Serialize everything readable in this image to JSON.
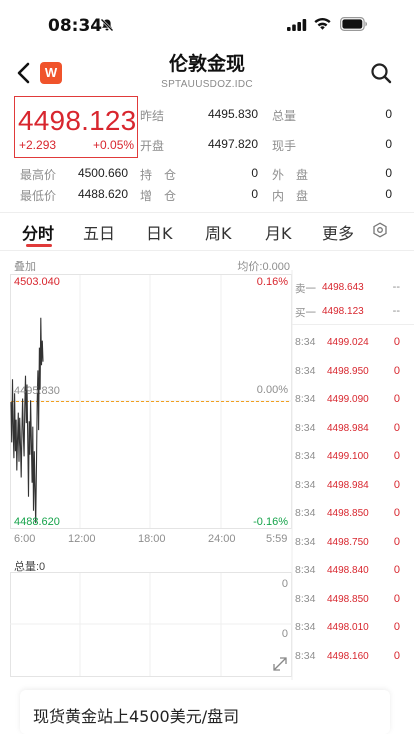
{
  "status_bar": {
    "time": "08:34"
  },
  "header": {
    "app_logo_letter": "W",
    "title": "伦敦金现",
    "subtitle": "SPTAUUSDOZ.IDC"
  },
  "quote": {
    "price": "4498.123",
    "change": "+2.293",
    "change_pct": "+0.05%",
    "stats_right": [
      {
        "label": "昨结",
        "value": "4495.830",
        "label2": "总量",
        "value2": "0"
      },
      {
        "label": "开盘",
        "value": "4497.820",
        "label2": "现手",
        "value2": "0"
      }
    ],
    "stats_bottom": [
      {
        "label": "最高价",
        "value": "4500.660",
        "label2": "持　仓",
        "value2": "0",
        "label3": "外　盘",
        "value3": "0"
      },
      {
        "label": "最低价",
        "value": "4488.620",
        "label2": "增　仓",
        "value2": "0",
        "label3": "内　盘",
        "value3": "0"
      }
    ]
  },
  "tabs": [
    "分时",
    "五日",
    "日K",
    "周K",
    "月K",
    "更多"
  ],
  "chart": {
    "overlay_label": "叠加",
    "avg_label": "均价:0.000",
    "y_top": "4503.040",
    "y_mid": "4495.830",
    "y_bottom": "4488.620",
    "pct_top": "0.16%",
    "pct_mid": "0.00%",
    "pct_bottom": "-0.16%",
    "x_ticks": [
      "6:00",
      "12:00",
      "18:00",
      "24:00",
      "5:59"
    ],
    "volume_label": "总量:0",
    "vol_axis_top": "0",
    "vol_axis_bottom": "0",
    "colors": {
      "price_line": "#333333",
      "prev_close_line": "#f0a020",
      "up": "#d8262e",
      "down": "#15a34a"
    }
  },
  "chart_data": {
    "type": "line",
    "title": "",
    "xlabel": "",
    "ylabel": "",
    "x_ticks": [
      "6:00",
      "12:00",
      "18:00",
      "24:00",
      "5:59"
    ],
    "ylim": [
      4488.62,
      4503.04
    ],
    "reference_line": 4495.83,
    "series": [
      {
        "values": [
          4495.8,
          4493.5,
          4497.1,
          4494.2,
          4492.6,
          4496.3,
          4493.0,
          4494.8,
          4491.9,
          4493.6,
          4495.2,
          4492.4,
          4494.9,
          4493.3,
          4491.5,
          4494.1,
          4496.0,
          4493.8,
          4492.7,
          4495.6,
          4497.3,
          4494.6,
          4496.8,
          4493.9,
          4490.4,
          4494.7,
          4492.8,
          4495.9,
          4493.4,
          4491.2,
          4494.4,
          4489.6,
          4493.0,
          4490.9,
          4488.9,
          4492.3,
          4495.8,
          4497.6,
          4494.2,
          4498.9,
          4496.5,
          4500.6,
          4497.9,
          4499.3,
          4498.1
        ]
      }
    ]
  },
  "order_book": {
    "ask_label": "卖一",
    "ask_price": "4498.643",
    "ask_vol": "--",
    "bid_label": "买一",
    "bid_price": "4498.123",
    "bid_vol": "--",
    "ticks": [
      {
        "time": "8:34",
        "price": "4499.024",
        "vol": "0"
      },
      {
        "time": "8:34",
        "price": "4498.950",
        "vol": "0"
      },
      {
        "time": "8:34",
        "price": "4499.090",
        "vol": "0"
      },
      {
        "time": "8:34",
        "price": "4498.984",
        "vol": "0"
      },
      {
        "time": "8:34",
        "price": "4499.100",
        "vol": "0"
      },
      {
        "time": "8:34",
        "price": "4498.984",
        "vol": "0"
      },
      {
        "time": "8:34",
        "price": "4498.850",
        "vol": "0"
      },
      {
        "time": "8:34",
        "price": "4498.750",
        "vol": "0"
      },
      {
        "time": "8:34",
        "price": "4498.840",
        "vol": "0"
      },
      {
        "time": "8:34",
        "price": "4498.850",
        "vol": "0"
      },
      {
        "time": "8:34",
        "price": "4498.010",
        "vol": "0"
      },
      {
        "time": "8:34",
        "price": "4498.160",
        "vol": "0"
      }
    ]
  },
  "news": {
    "headline": "现货黄金站上4500美元/盘司"
  }
}
